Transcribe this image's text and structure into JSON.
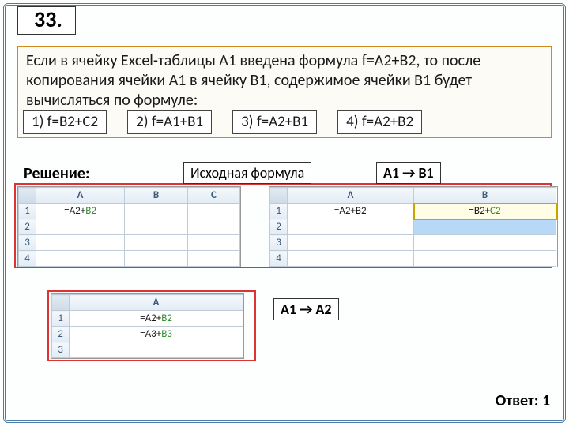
{
  "qnum": "33.",
  "question": "Если в ячейку Excel-таблицы A1 введена формула f=A2+B2, то после копирования ячейки A1 в ячейку B1, содержимое ячейки B1 будет вычисляться по формуле:",
  "options": {
    "o1": "1) f=B2+C2",
    "o2": "2) f=A1+B1",
    "o3": "3) f=A2+B1",
    "o4": "4) f=A2+B2"
  },
  "labels": {
    "solution": "Решение:",
    "source": "Исходная формула",
    "a1b1": "A1 → B1",
    "a1a2": "A1 → A2",
    "answer": "Ответ: 1"
  },
  "grid1": {
    "cols": {
      "A": "A",
      "B": "B",
      "C": "C"
    },
    "rows": [
      "1",
      "2",
      "3",
      "4"
    ],
    "A1_pre": "=A2+",
    "A1_b2": "B2"
  },
  "grid2": {
    "cols": {
      "A": "A",
      "B": "B"
    },
    "rows": [
      "1",
      "2",
      "3",
      "4"
    ],
    "A1": "=A2+B2",
    "B1_pre": "=B2+",
    "B1_c2": "C2"
  },
  "grid3": {
    "cols": {
      "A": "A"
    },
    "rows": [
      "1",
      "2",
      "3"
    ],
    "A1_pre": "=A2+",
    "A1_b2": "B2",
    "A2_pre": "=A3+",
    "A2_b3": "B3"
  }
}
